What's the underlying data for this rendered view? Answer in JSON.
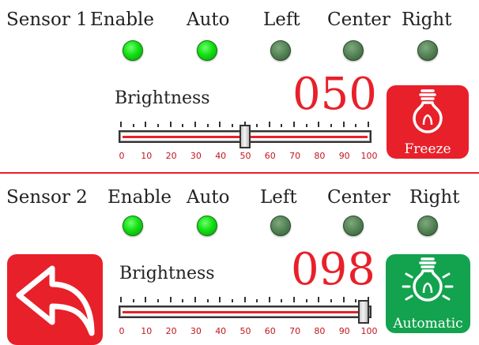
{
  "sensor1": {
    "title": "Sensor 1",
    "indicators": [
      {
        "label": "Enable",
        "state": "on"
      },
      {
        "label": "Auto",
        "state": "on"
      },
      {
        "label": "Left",
        "state": "off"
      },
      {
        "label": "Center",
        "state": "off"
      },
      {
        "label": "Right",
        "state": "off"
      }
    ],
    "brightness_label": "Brightness",
    "value_text": "050",
    "slider_value": 50,
    "mode_button": {
      "label": "Freeze",
      "icon": "lightbulb-icon",
      "color": "#e8202a"
    }
  },
  "sensor2": {
    "title": "Sensor 2",
    "indicators": [
      {
        "label": "Enable",
        "state": "on"
      },
      {
        "label": "Auto",
        "state": "on"
      },
      {
        "label": "Left",
        "state": "off"
      },
      {
        "label": "Center",
        "state": "off"
      },
      {
        "label": "Right",
        "state": "off"
      }
    ],
    "brightness_label": "Brightness",
    "value_text": "098",
    "slider_value": 98,
    "mode_button": {
      "label": "Automatic",
      "icon": "lightbulb-glowing-icon",
      "color": "#13a34f"
    }
  },
  "slider_scale": [
    "0",
    "10",
    "20",
    "30",
    "40",
    "50",
    "60",
    "70",
    "80",
    "90",
    "100"
  ],
  "back_button": {
    "icon": "back-arrow-icon",
    "color": "#e8202a"
  },
  "colors": {
    "accent": "#e8202a",
    "led_on": "#13e013",
    "led_off": "#4f7f50",
    "auto_green": "#13a34f"
  }
}
